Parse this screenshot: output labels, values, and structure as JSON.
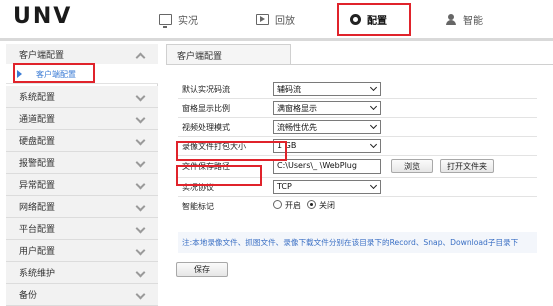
{
  "header": {
    "logo": "UNV",
    "nav": [
      {
        "label": "实况",
        "icon": "monitor-icon"
      },
      {
        "label": "回放",
        "icon": "playback-icon"
      },
      {
        "label": "配置",
        "icon": "gear-icon",
        "active": true
      },
      {
        "label": "智能",
        "icon": "smart-person-icon"
      }
    ]
  },
  "sidebar": {
    "items": [
      {
        "label": "客户端配置",
        "expanded": true
      },
      {
        "label": "系统配置"
      },
      {
        "label": "通道配置"
      },
      {
        "label": "硬盘配置"
      },
      {
        "label": "报警配置"
      },
      {
        "label": "异常配置"
      },
      {
        "label": "网络配置"
      },
      {
        "label": "平台配置"
      },
      {
        "label": "用户配置"
      },
      {
        "label": "系统维护"
      },
      {
        "label": "备份"
      }
    ],
    "sub_item": "客户端配置"
  },
  "main": {
    "tab": "客户端配置",
    "fields": [
      {
        "label": "默认实况码流",
        "value": "辅码流"
      },
      {
        "label": "窗格显示比例",
        "value": "满窗格显示"
      },
      {
        "label": "视频处理模式",
        "value": "流畅性优先"
      },
      {
        "label": "录像文件打包大小",
        "value": "1 GB"
      },
      {
        "label": "文件保存路径",
        "value": "C:\\Users\\_       \\WebPlug"
      },
      {
        "label": "实况协议",
        "value": "TCP"
      },
      {
        "label": "智能标记",
        "value": ""
      }
    ],
    "browse_label": "浏览",
    "open_folder_label": "打开文件夹",
    "radio_on_label": "开启",
    "radio_off_label": "关闭",
    "radio_selected": "关闭",
    "note": "注:本地录像文件、抓图文件、录像下载文件分别在该目录下的Record、Snap、Download子目录下",
    "save_label": "保存"
  },
  "colors": {
    "highlight_box": "#e0232b",
    "link_blue": "#3a7bd5",
    "note_text": "#3a6fc4"
  }
}
